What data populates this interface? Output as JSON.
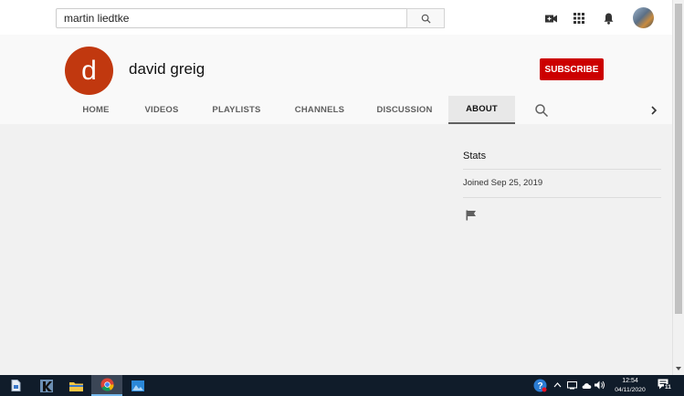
{
  "search": {
    "value": "martin liedtke"
  },
  "channel": {
    "initial": "d",
    "name": "david greig",
    "subscribe_label": "SUBSCRIBE",
    "avatar_color": "#c1380f"
  },
  "tabs": [
    {
      "label": "HOME",
      "active": false
    },
    {
      "label": "VIDEOS",
      "active": false
    },
    {
      "label": "PLAYLISTS",
      "active": false
    },
    {
      "label": "CHANNELS",
      "active": false
    },
    {
      "label": "DISCUSSION",
      "active": false
    },
    {
      "label": "ABOUT",
      "active": true
    }
  ],
  "about": {
    "stats_title": "Stats",
    "joined": "Joined Sep 25, 2019"
  },
  "taskbar": {
    "time": "12:54",
    "date": "04/11/2020",
    "notification_count": "11"
  },
  "colors": {
    "accent_red": "#cc0000",
    "taskbar": "#101c2a"
  }
}
